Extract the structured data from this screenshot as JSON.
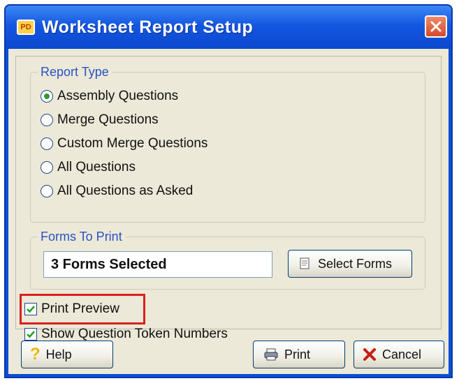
{
  "window": {
    "title": "Worksheet Report Setup",
    "app_icon_text": "PD"
  },
  "report_type": {
    "legend": "Report Type",
    "options": [
      {
        "label": "Assembly Questions",
        "selected": true
      },
      {
        "label": "Merge Questions",
        "selected": false
      },
      {
        "label": "Custom Merge Questions",
        "selected": false
      },
      {
        "label": "All Questions",
        "selected": false
      },
      {
        "label": "All Questions as Asked",
        "selected": false
      }
    ]
  },
  "forms_to_print": {
    "legend": "Forms To Print",
    "value": "3 Forms Selected",
    "select_button_label": "Select Forms"
  },
  "options": {
    "print_preview": {
      "label": "Print Preview",
      "checked": true
    },
    "show_token_numbers": {
      "label": "Show Question Token Numbers",
      "checked": true
    }
  },
  "buttons": {
    "help": "Help",
    "print": "Print",
    "cancel": "Cancel"
  },
  "colors": {
    "title_bar": "#1457e0",
    "highlight": "#d8201e",
    "dialog_face": "#ece9d8"
  }
}
